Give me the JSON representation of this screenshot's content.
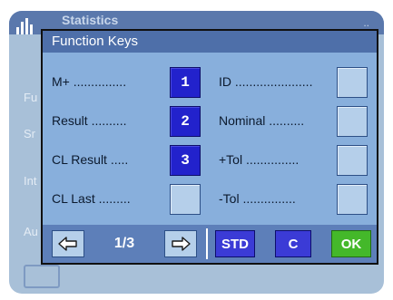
{
  "background_screen": {
    "title": "Statistics",
    "title_right": "..",
    "labels": [
      "Fu",
      "Sr",
      "Int",
      "Au"
    ]
  },
  "dialog": {
    "title": "Function Keys",
    "left_column": [
      {
        "label": "M+",
        "dots": "...............",
        "key": "1",
        "active": true
      },
      {
        "label": "Result",
        "dots": "..........",
        "key": "2",
        "active": true
      },
      {
        "label": "CL Result",
        "dots": ".....",
        "key": "3",
        "active": true
      },
      {
        "label": "CL Last",
        "dots": ".........",
        "key": "",
        "active": false
      }
    ],
    "right_column": [
      {
        "label": "ID",
        "dots": "......................",
        "key": "",
        "active": false
      },
      {
        "label": "Nominal",
        "dots": "..........",
        "key": "",
        "active": false
      },
      {
        "label": "+Tol",
        "dots": "...............",
        "key": "",
        "active": false
      },
      {
        "label": "-Tol",
        "dots": "...............",
        "key": "",
        "active": false
      }
    ],
    "footer": {
      "page_indicator": "1/3",
      "std_label": "STD",
      "c_label": "C",
      "ok_label": "OK"
    }
  },
  "colors": {
    "dialog_bg": "#5d7fb9",
    "body_bg": "#88afdc",
    "active_key": "#2222cc",
    "ok_green": "#44b82a"
  },
  "icons": [
    "bar-chart-icon",
    "arrow-left-icon",
    "arrow-right-icon"
  ]
}
